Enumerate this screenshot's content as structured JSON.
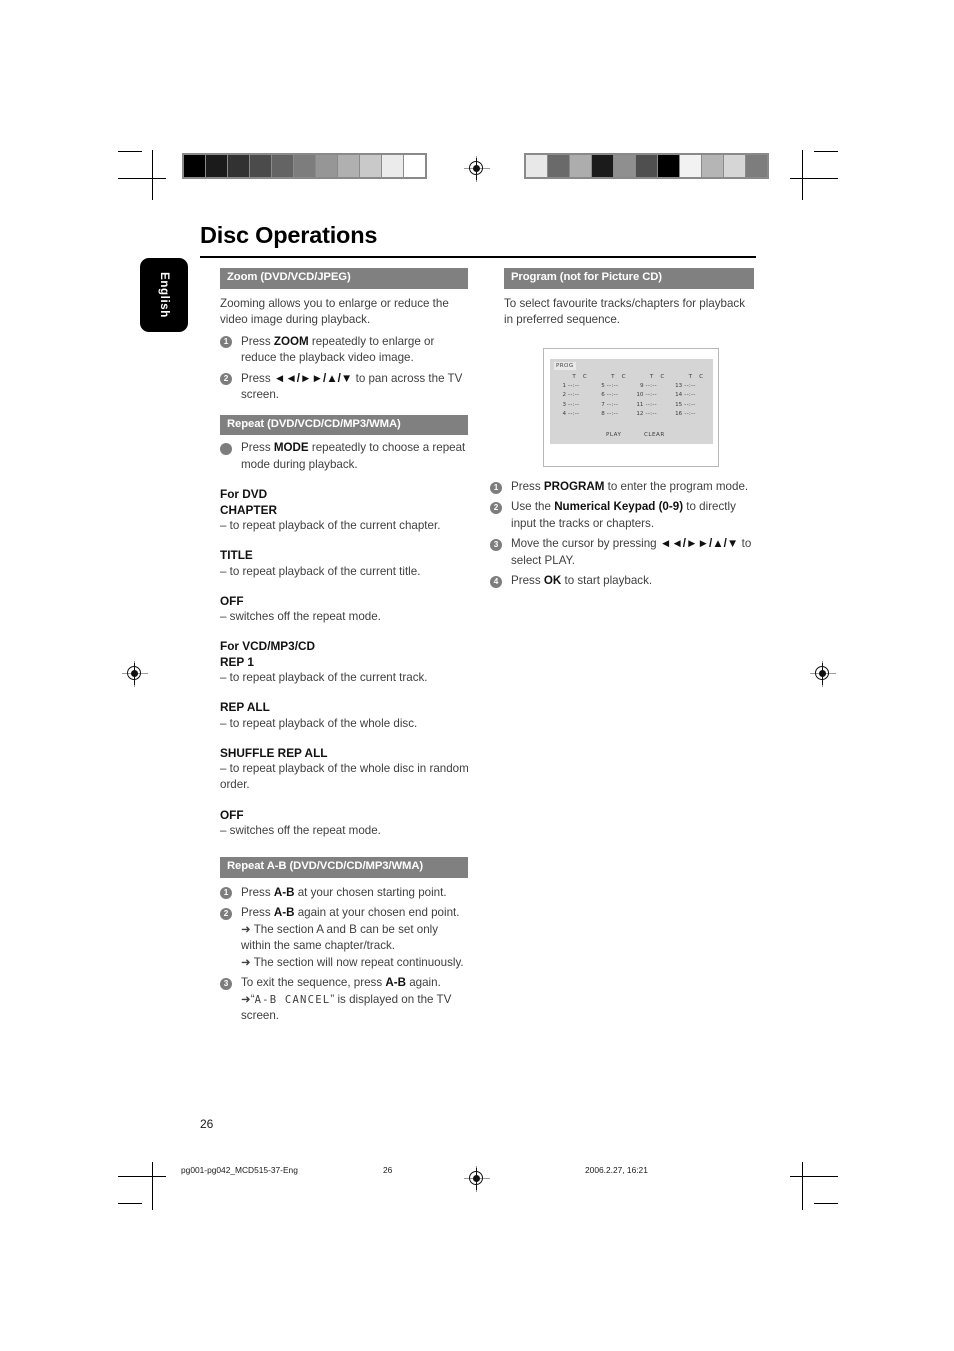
{
  "document": {
    "page_title": "Disc Operations",
    "language_tab": "English",
    "page_number": "26"
  },
  "footer": {
    "file_name": "pg001-pg042_MCD515-37-Eng",
    "page": "26",
    "timestamp": "2006.2.27, 16:21"
  },
  "colorbars": {
    "left_swatches": [
      "#000000",
      "#1b1b1b",
      "#323232",
      "#4b4b4b",
      "#646464",
      "#7d7d7d",
      "#969696",
      "#b0b0b0",
      "#c9c9c9",
      "#ebebeb",
      "#ffffff"
    ],
    "right_swatches": [
      "#e8e8e8",
      "#6a6a6a",
      "#adadad",
      "#1b1b1b",
      "#8f8f8f",
      "#4f4f4f",
      "#000000",
      "#f2f2f2",
      "#b5b5b5",
      "#d6d6d6",
      "#7d7d7d"
    ]
  },
  "left_column": {
    "zoom": {
      "heading": "Zoom (DVD/VCD/JPEG)",
      "intro": "Zooming allows you to enlarge or reduce the video image during playback.",
      "steps": [
        {
          "num": "1",
          "pre": "Press ",
          "bold": "ZOOM",
          "post": " repeatedly to enlarge or reduce the playback video image."
        },
        {
          "num": "2",
          "pre": "Press ",
          "bold": "◄◄/►►/▲/▼",
          "post": " to pan across the TV screen."
        }
      ]
    },
    "repeat": {
      "heading": "Repeat (DVD/VCD/CD/MP3/WMA)",
      "bullet_pre": "Press ",
      "bullet_bold": "MODE",
      "bullet_post": " repeatedly to choose a repeat mode during playback.",
      "groups": [
        {
          "title": "For DVD",
          "modes": [
            {
              "name": "CHAPTER",
              "desc": "– to repeat playback of the current chapter."
            },
            {
              "name": "TITLE",
              "desc": "– to repeat playback of the current title."
            },
            {
              "name": "OFF",
              "desc": "– switches off the repeat mode."
            }
          ]
        },
        {
          "title": "For VCD/MP3/CD",
          "modes": [
            {
              "name": "REP 1",
              "desc": "– to repeat playback of the current track."
            },
            {
              "name": "REP ALL",
              "desc": "– to repeat playback of the whole disc."
            },
            {
              "name": "SHUFFLE REP ALL",
              "desc": "– to repeat playback of the whole disc in random order."
            },
            {
              "name": "OFF",
              "desc": "– switches off the repeat mode."
            }
          ]
        }
      ]
    },
    "repeat_ab": {
      "heading": "Repeat A-B (DVD/VCD/CD/MP3/WMA)",
      "step1": {
        "num": "1",
        "pre": "Press ",
        "bold": "A-B",
        "post": " at your chosen starting point."
      },
      "step2": {
        "num": "2",
        "pre": "Press ",
        "bold": "A-B",
        "post": " again at your chosen end point.",
        "sub1": "➜ The section A and B can be set only within the same chapter/track.",
        "sub2": "➜ The section will now repeat continuously."
      },
      "step3": {
        "num": "3",
        "pre": "To exit the sequence, press ",
        "bold": "A-B",
        "post": " again.",
        "sub_arrow": "➜",
        "sub_quote_open": "“",
        "sub_lcd": "A-B CANCEL",
        "sub_quote_close": "”",
        "sub_tail": " is displayed on the TV screen."
      }
    }
  },
  "right_column": {
    "program": {
      "heading": "Program (not for Picture CD)",
      "intro": "To select favourite tracks/chapters for playback in preferred sequence.",
      "screen": {
        "tag": "PROG",
        "col_header": "T  C",
        "empty_value": "--:--",
        "rows": [
          [
            "1",
            "5",
            "9",
            "13"
          ],
          [
            "2",
            "6",
            "10",
            "14"
          ],
          [
            "3",
            "7",
            "11",
            "15"
          ],
          [
            "4",
            "8",
            "12",
            "16"
          ]
        ],
        "action_play": "PLAY",
        "action_clear": "CLEAR"
      },
      "steps": [
        {
          "num": "1",
          "pre": "Press ",
          "bold": "PROGRAM",
          "post": " to enter the program mode."
        },
        {
          "num": "2",
          "pre": "Use the ",
          "bold": "Numerical Keypad (0-9)",
          "post": " to directly input the tracks or chapters."
        },
        {
          "num": "3",
          "pre": "Move the cursor by pressing ",
          "bold": "◄◄/►►/▲/▼",
          "post": " to select PLAY."
        },
        {
          "num": "4",
          "pre": "Press ",
          "bold": "OK",
          "post": " to start playback."
        }
      ]
    }
  }
}
